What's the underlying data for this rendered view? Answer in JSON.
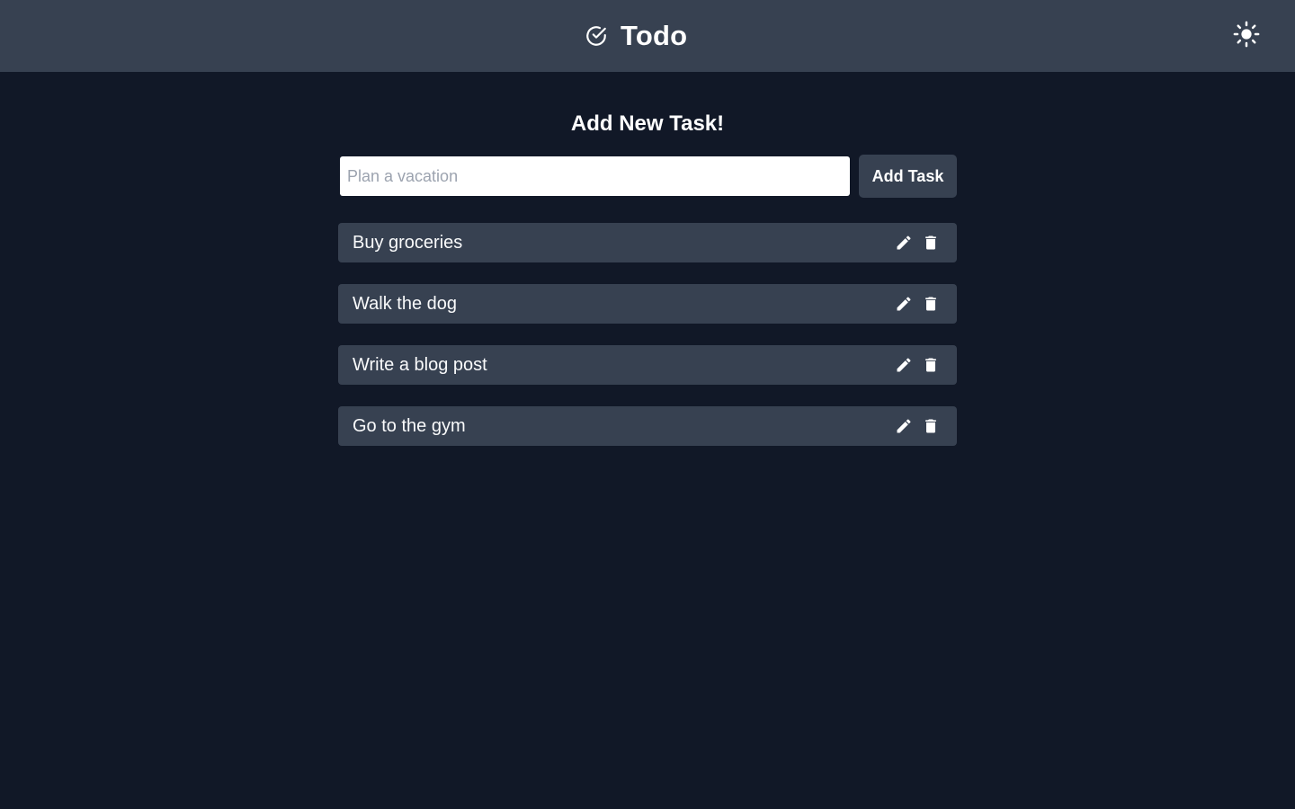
{
  "header": {
    "title": "Todo",
    "logo_icon": "check-circle-icon",
    "theme_toggle_icon": "sun-icon"
  },
  "main": {
    "heading": "Add New Task!",
    "input": {
      "value": "",
      "placeholder": "Plan a vacation"
    },
    "add_button_label": "Add Task"
  },
  "tasks": [
    {
      "label": "Buy groceries"
    },
    {
      "label": "Walk the dog"
    },
    {
      "label": "Write a blog post"
    },
    {
      "label": "Go to the gym"
    }
  ],
  "task_action_icons": [
    "pencil-icon",
    "trash-icon"
  ],
  "colors": {
    "background": "#111827",
    "surface": "#374151",
    "text": "#ffffff",
    "input_background": "#ffffff",
    "placeholder": "#9ca3af"
  }
}
